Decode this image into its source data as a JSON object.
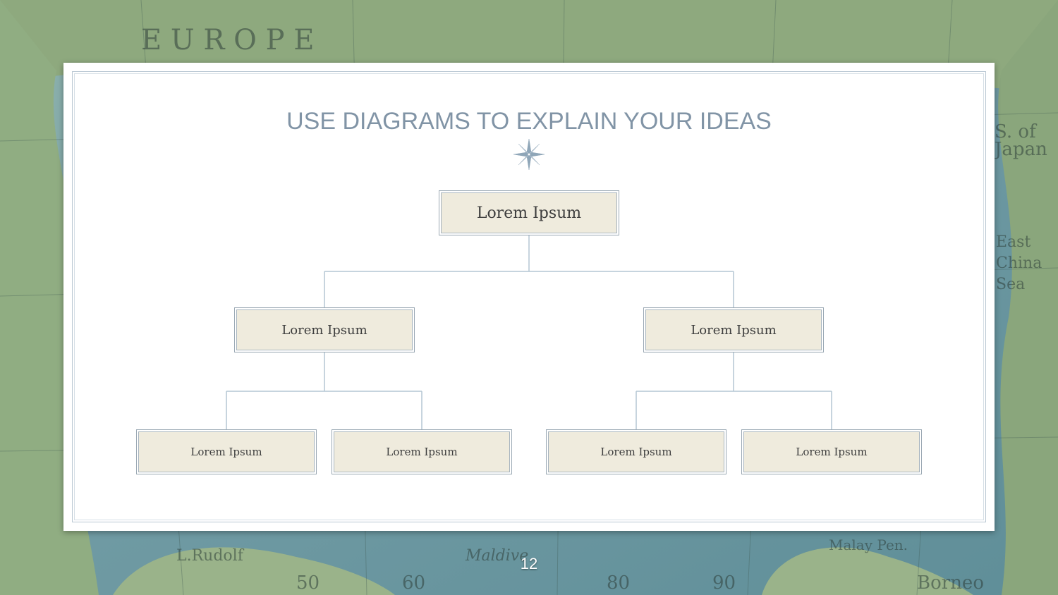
{
  "slide": {
    "title": "USE DIAGRAMS TO EXPLAIN YOUR IDEAS",
    "page_number": "12"
  },
  "diagram": {
    "root": "Lorem Ipsum",
    "level2": [
      "Lorem Ipsum",
      "Lorem Ipsum"
    ],
    "level3": [
      "Lorem Ipsum",
      "Lorem Ipsum",
      "Lorem Ipsum",
      "Lorem Ipsum"
    ]
  },
  "colors": {
    "title": "#8194a6",
    "node_fill": "#efebdd",
    "connector": "#b4c6d3"
  },
  "icons": {
    "compass": "compass-rose-icon"
  }
}
